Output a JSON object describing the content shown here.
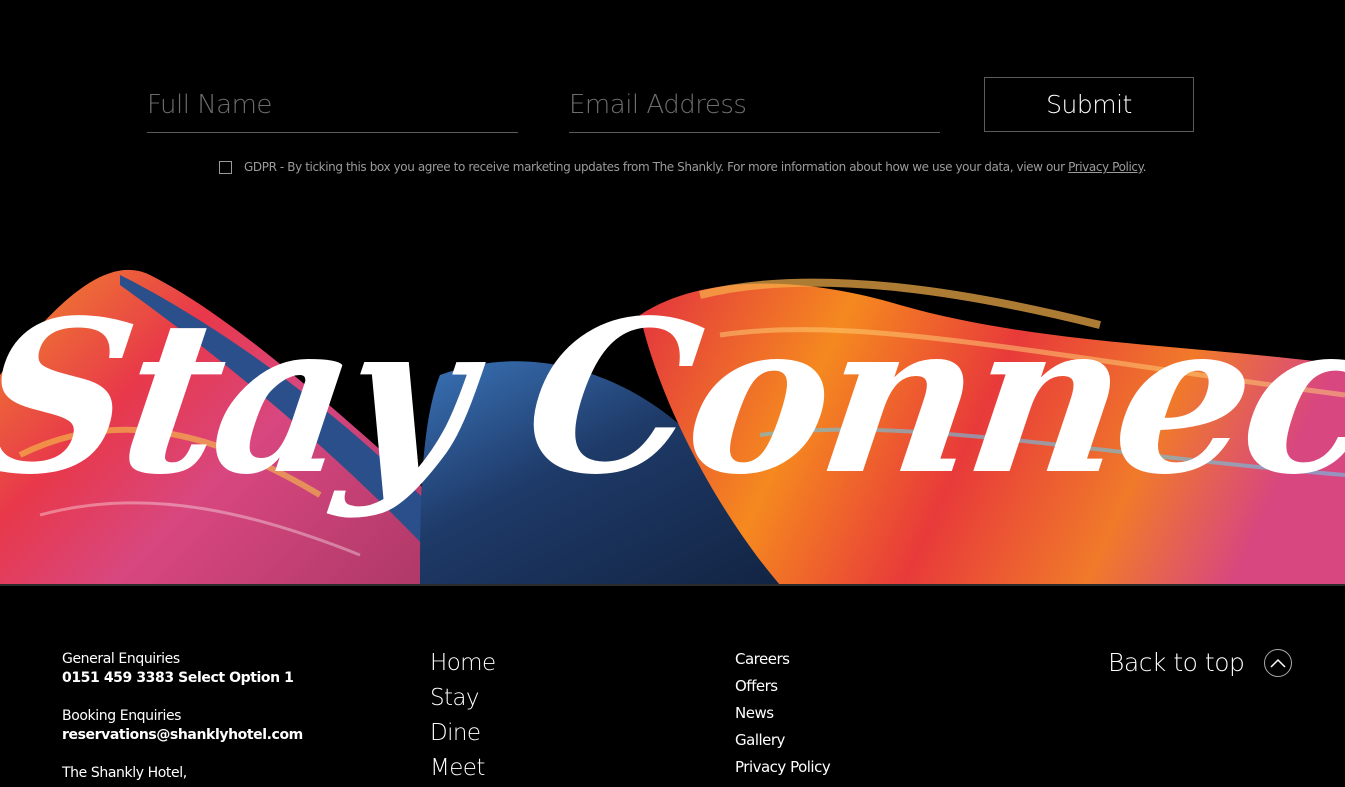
{
  "form": {
    "name_placeholder": "Full Name",
    "email_placeholder": "Email Address",
    "submit_label": "Submit",
    "gdpr_text": "GDPR - By ticking this box you agree to receive marketing updates from The Shankly. For more information about how we use your data, view our ",
    "gdpr_link": "Privacy Policy",
    "gdpr_tail": "."
  },
  "banner": {
    "script_text": "Stay Connected"
  },
  "contact": {
    "general_label": "General Enquiries",
    "general_phone": "0151 459 3383 Select Option 1",
    "booking_label": "Booking Enquiries",
    "booking_email": "reservations@shanklyhotel.com",
    "address_line1": "The Shankly Hotel,"
  },
  "nav_main": [
    "Home",
    "Stay",
    "Dine",
    "Meet"
  ],
  "nav_side": [
    "Careers",
    "Offers",
    "News",
    "Gallery",
    "Privacy Policy"
  ],
  "back_to_top": {
    "label": "Back to top",
    "icon": "chevron-up-icon"
  },
  "colors": {
    "background": "#000000",
    "text": "#ffffff",
    "muted": "#9b9b9b",
    "banner_red": "#e63a3a",
    "banner_orange": "#f5891f",
    "banner_navy": "#1e3a68",
    "banner_pink": "#d8477f"
  }
}
